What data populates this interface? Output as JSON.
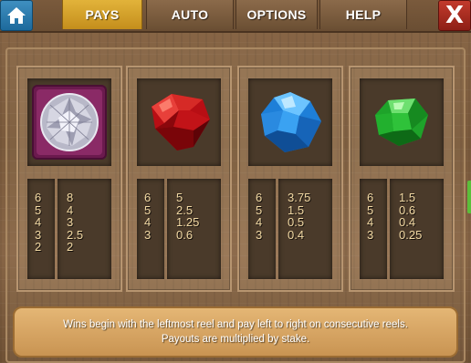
{
  "nav": {
    "tabs": [
      {
        "label": "PAYS",
        "active": true
      },
      {
        "label": "AUTO",
        "active": false
      },
      {
        "label": "OPTIONS",
        "active": false
      },
      {
        "label": "HELP",
        "active": false
      }
    ],
    "home_icon": "home-icon",
    "close_label": "X"
  },
  "symbols": [
    {
      "gem": "purple-diamond-icon",
      "counts": [
        "6",
        "5",
        "4",
        "3",
        "2"
      ],
      "payouts": [
        "8",
        "4",
        "3",
        "2.5",
        "2"
      ]
    },
    {
      "gem": "red-gem-icon",
      "counts": [
        "6",
        "5",
        "4",
        "3"
      ],
      "payouts": [
        "5",
        "2.5",
        "1.25",
        "0.6"
      ]
    },
    {
      "gem": "blue-gem-icon",
      "counts": [
        "6",
        "5",
        "4",
        "3"
      ],
      "payouts": [
        "3.75",
        "1.5",
        "0.5",
        "0.4"
      ]
    },
    {
      "gem": "green-gem-icon",
      "counts": [
        "6",
        "5",
        "4",
        "3"
      ],
      "payouts": [
        "1.5",
        "0.6",
        "0.4",
        "0.25"
      ]
    }
  ],
  "footer": {
    "line1": "Wins begin with the leftmost reel and pay left to right on consecutive reels.",
    "line2": "Payouts are multiplied by stake."
  },
  "colors": {
    "active_tab": "#d9a22c",
    "home_button": "#2a7db0",
    "close_button": "#a82a1f",
    "payout_text": "#f2d9a4"
  }
}
